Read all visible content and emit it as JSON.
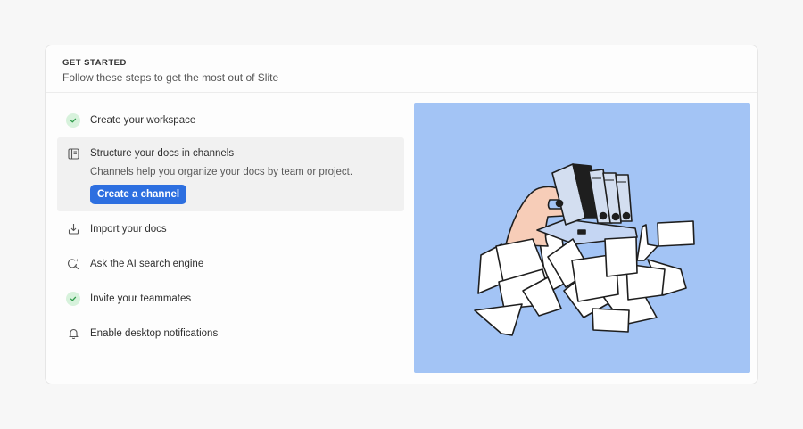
{
  "header": {
    "eyebrow": "GET STARTED",
    "subtitle": "Follow these steps to get the most out of Slite"
  },
  "steps": [
    {
      "label": "Create your workspace",
      "icon": "check-icon",
      "completed": true
    },
    {
      "label": "Structure your docs in channels",
      "icon": "channel-icon",
      "completed": false,
      "active": true,
      "description": "Channels help you organize your docs by team or project.",
      "cta": "Create a channel"
    },
    {
      "label": "Import your docs",
      "icon": "import-icon",
      "completed": false
    },
    {
      "label": "Ask the AI search engine",
      "icon": "ai-search-icon",
      "completed": false
    },
    {
      "label": "Invite your teammates",
      "icon": "check-icon",
      "completed": true
    },
    {
      "label": "Enable desktop notifications",
      "icon": "bell-icon",
      "completed": false
    }
  ],
  "colors": {
    "accent": "#2d6fe0",
    "illustration_bg": "#a3c4f5",
    "check_bg": "#d7f2dc",
    "check_mark": "#2e9b4a"
  }
}
